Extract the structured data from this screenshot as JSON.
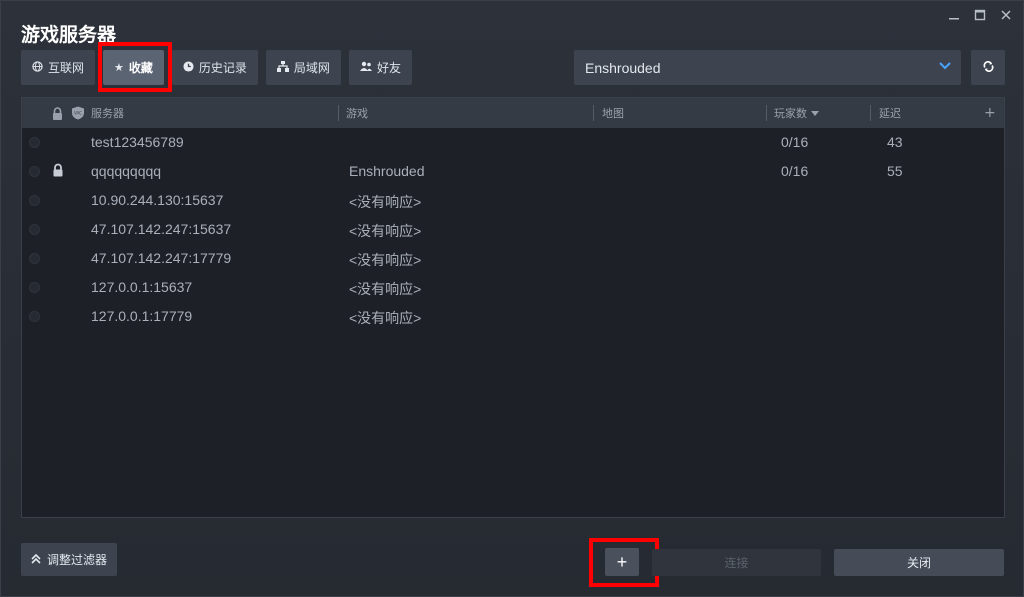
{
  "window": {
    "title": "游戏服务器",
    "controls": [
      "minimize-icon",
      "maximize-icon",
      "close-icon"
    ]
  },
  "tabs": [
    {
      "label": "互联网",
      "icon": "globe-icon",
      "active": false
    },
    {
      "label": "收藏",
      "icon": "star-icon",
      "active": true
    },
    {
      "label": "历史记录",
      "icon": "clock-icon",
      "active": false
    },
    {
      "label": "局域网",
      "icon": "lan-icon",
      "active": false
    },
    {
      "label": "好友",
      "icon": "friends-icon",
      "active": false
    }
  ],
  "game_filter": {
    "selected": "Enshrouded"
  },
  "table": {
    "headers": {
      "server": "服务器",
      "game": "游戏",
      "map": "地图",
      "players": "玩家数",
      "ping": "延迟",
      "add": "+"
    },
    "rows": [
      {
        "server": "test123456789",
        "game": "",
        "players": "0/16",
        "ping": "43",
        "locked": false
      },
      {
        "server": "qqqqqqqqq",
        "game": "Enshrouded",
        "players": "0/16",
        "ping": "55",
        "locked": true
      },
      {
        "server": "10.90.244.130:15637",
        "game": "<没有响应>",
        "players": "",
        "ping": "",
        "locked": false
      },
      {
        "server": "47.107.142.247:15637",
        "game": "<没有响应>",
        "players": "",
        "ping": "",
        "locked": false
      },
      {
        "server": "47.107.142.247:17779",
        "game": "<没有响应>",
        "players": "",
        "ping": "",
        "locked": false
      },
      {
        "server": "127.0.0.1:15637",
        "game": "<没有响应>",
        "players": "",
        "ping": "",
        "locked": false
      },
      {
        "server": "127.0.0.1:17779",
        "game": "<没有响应>",
        "players": "",
        "ping": "",
        "locked": false
      }
    ]
  },
  "footer": {
    "filters_label": "调整过滤器",
    "add_label": "+",
    "connect_label": "连接",
    "close_label": "关闭"
  },
  "colors": {
    "highlight": "#ff0000",
    "accent": "#4aa3ff"
  }
}
